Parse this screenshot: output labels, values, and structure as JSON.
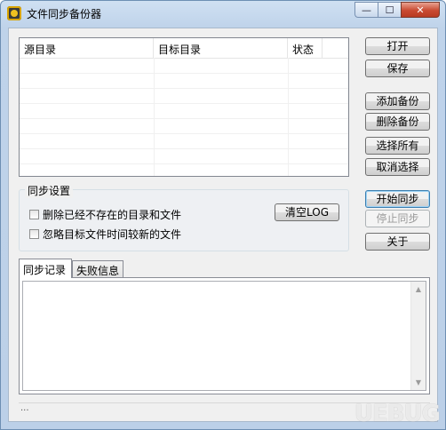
{
  "window": {
    "title": "文件同步备份器",
    "caption": {
      "minimize": "—",
      "maximize": "☐",
      "close": "✕"
    }
  },
  "listview": {
    "columns": [
      "源目录",
      "目标目录",
      "状态"
    ],
    "rows": []
  },
  "buttons": {
    "open": "打开",
    "save": "保存",
    "add_backup": "添加备份",
    "delete_backup": "删除备份",
    "select_all": "选择所有",
    "deselect": "取消选择",
    "start_sync": "开始同步",
    "stop_sync": "停止同步",
    "about": "关于",
    "clear_log": "清空LOG"
  },
  "sync_settings": {
    "title": "同步设置",
    "option_delete_missing": {
      "label": "删除已经不存在的目录和文件",
      "checked": false
    },
    "option_ignore_newer": {
      "label": "忽略目标文件时间较新的文件",
      "checked": false
    }
  },
  "tabs": {
    "items": [
      {
        "label": "同步记录",
        "active": true
      },
      {
        "label": "失败信息",
        "active": false
      }
    ]
  },
  "log": {
    "content": ""
  },
  "statusbar": {
    "text": "..."
  },
  "watermark": {
    "text": "UEBUG"
  }
}
